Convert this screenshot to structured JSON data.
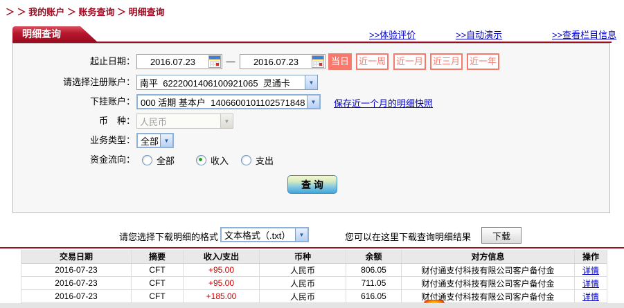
{
  "breadcrumb": {
    "text": "＞ ＞ 我的账户 ＞ 账务查询 ＞ 明细查询"
  },
  "tab": {
    "label": "明细查询"
  },
  "top_links": {
    "experience": ">>体验评价",
    "demo": ">>自动演示",
    "column_info": ">>查看栏目信息"
  },
  "form": {
    "date_label": "起止日期：",
    "date_from": "2016.07.23",
    "date_to": "2016.07.23",
    "date_dash": "—",
    "quick_buttons": [
      "当日",
      "近一周",
      "近一月",
      "近三月",
      "近一年"
    ],
    "quick_selected": "当日",
    "account_label": "请选择注册账户：",
    "account_value": "南平  6222001406100921065  灵通卡",
    "sub_account_label": "下挂账户：",
    "sub_account_value": "000 活期 基本户  1406600101102571848",
    "snapshot_link": "保存近一个月的明细快照",
    "currency_label": "币　种：",
    "currency_value": "人民币",
    "biz_label": "业务类型：",
    "biz_value": "全部",
    "flow_label": "资金流向：",
    "flow_options": [
      "全部",
      "收入",
      "支出"
    ],
    "flow_selected": "收入",
    "query_button": "查 询",
    "dropdown_glyph": "▼"
  },
  "download": {
    "format_label": "请您选择下载明细的格式",
    "format_value": "文本格式（.txt）",
    "hint": "您可以在这里下载查询明细结果",
    "button_label": "下载"
  },
  "table": {
    "headers": [
      "交易日期",
      "摘要",
      "收入/支出",
      "币种",
      "余额",
      "对方信息",
      "操作"
    ],
    "rows": [
      {
        "date": "2016-07-23",
        "summary": "CFT",
        "amount": "+95.00",
        "currency": "人民币",
        "balance": "806.05",
        "counterparty": "财付通支付科技有限公司客户备付金",
        "action": "详情"
      },
      {
        "date": "2016-07-23",
        "summary": "CFT",
        "amount": "+95.00",
        "currency": "人民币",
        "balance": "711.05",
        "counterparty": "财付通支付科技有限公司客户备付金",
        "action": "详情"
      },
      {
        "date": "2016-07-23",
        "summary": "CFT",
        "amount": "+185.00",
        "currency": "人民币",
        "balance": "616.05",
        "counterparty": "财付通支付科技有限公司客户备付金",
        "action": "详情"
      }
    ]
  },
  "colors": {
    "brand_red": "#9e0c20",
    "link_blue": "#0000cc",
    "salmon": "#f8786c",
    "amount_red": "#cc0000"
  }
}
